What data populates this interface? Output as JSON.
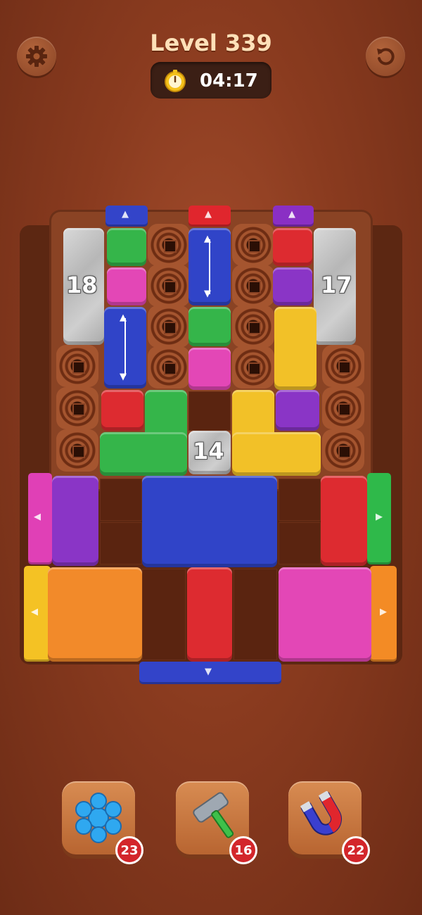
{
  "header": {
    "level_label": "Level 339",
    "timer": "04:17",
    "settings_icon": "gear-icon",
    "restart_icon": "restart-icon"
  },
  "board": {
    "numbered_blocks": [
      "18",
      "17",
      "14"
    ],
    "gate_colors": {
      "top_blue": "#3344c9",
      "top_red": "#e0262d",
      "top_purple": "#8a2fc4",
      "left_magenta": "#e040b6",
      "left_yellow": "#f4c224",
      "right_green": "#2fb94a",
      "right_orange": "#f38b25",
      "bottom_blue": "#3344c9"
    },
    "block_colors": {
      "green": "#35b54a",
      "magenta": "#e347b6",
      "blue": "#3044c8",
      "red": "#dd2b30",
      "purple": "#8a35c6",
      "yellow": "#f2c128",
      "orange": "#f28a2a",
      "gray": "#c3c3c3"
    }
  },
  "tools": [
    {
      "name": "freeze",
      "icon": "snowflake-icon",
      "count": "23"
    },
    {
      "name": "hammer",
      "icon": "hammer-icon",
      "count": "16"
    },
    {
      "name": "magnet",
      "icon": "magnet-icon",
      "count": "22"
    }
  ]
}
